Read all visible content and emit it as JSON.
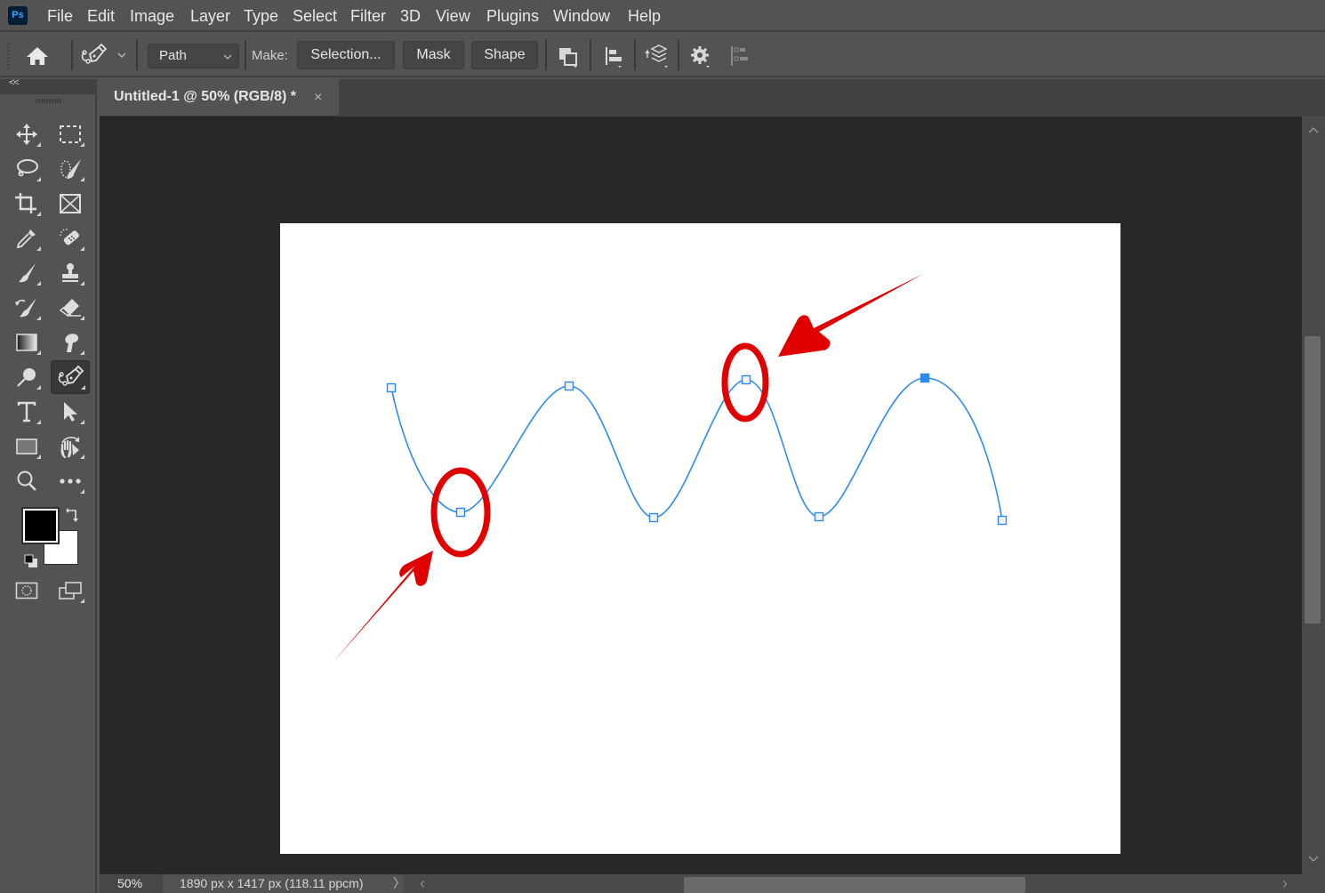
{
  "app": {
    "logo": "Ps",
    "menu": [
      "File",
      "Edit",
      "Image",
      "Layer",
      "Type",
      "Select",
      "Filter",
      "3D",
      "View",
      "Plugins",
      "Window",
      "Help"
    ]
  },
  "options_bar": {
    "tool_icon": "pen-tool-icon",
    "mode_select": "Path",
    "make_label": "Make:",
    "buttons": [
      "Selection...",
      "Mask",
      "Shape"
    ],
    "icons": [
      "path-operations-icon",
      "path-alignment-icon",
      "path-arrangement-icon",
      "gear-icon",
      "align-edges-icon"
    ]
  },
  "document": {
    "tab_title": "Untitled-1 @ 50% (RGB/8) *",
    "close_glyph": "×"
  },
  "toolbox": {
    "collapse_glyph": "<<",
    "tools": [
      [
        "move-tool",
        "rectangular-marquee-tool"
      ],
      [
        "lasso-tool",
        "quick-selection-tool"
      ],
      [
        "crop-tool",
        "frame-tool"
      ],
      [
        "eyedropper-tool",
        "spot-healing-brush-tool"
      ],
      [
        "brush-tool",
        "clone-stamp-tool"
      ],
      [
        "history-brush-tool",
        "eraser-tool"
      ],
      [
        "gradient-tool",
        "smudge-tool"
      ],
      [
        "dodge-tool",
        "curvature-pen-tool"
      ],
      [
        "type-tool",
        "path-selection-tool"
      ],
      [
        "rectangle-tool",
        "rotate-view-tool"
      ],
      [
        "zoom-tool",
        "edit-toolbar"
      ]
    ],
    "active_tool": "curvature-pen-tool",
    "foreground_color": "#000000",
    "background_color": "#ffffff"
  },
  "canvas": {
    "path_color": "#2d8ceb",
    "annotation_color": "#e00000",
    "anchor_points": [
      {
        "name": "anchor-1",
        "selected": false
      },
      {
        "name": "anchor-2",
        "selected": false,
        "highlighted": true
      },
      {
        "name": "anchor-3",
        "selected": false
      },
      {
        "name": "anchor-4",
        "selected": false
      },
      {
        "name": "anchor-5",
        "selected": false,
        "highlighted": true
      },
      {
        "name": "anchor-6",
        "selected": false
      },
      {
        "name": "anchor-7",
        "selected": true
      },
      {
        "name": "anchor-8",
        "selected": false
      }
    ]
  },
  "status": {
    "zoom": "50%",
    "doc_info": "1890 px x 1417 px (118.11 ppcm)",
    "more_glyph": "〉",
    "scroll_left": "‹",
    "scroll_right": "›"
  }
}
